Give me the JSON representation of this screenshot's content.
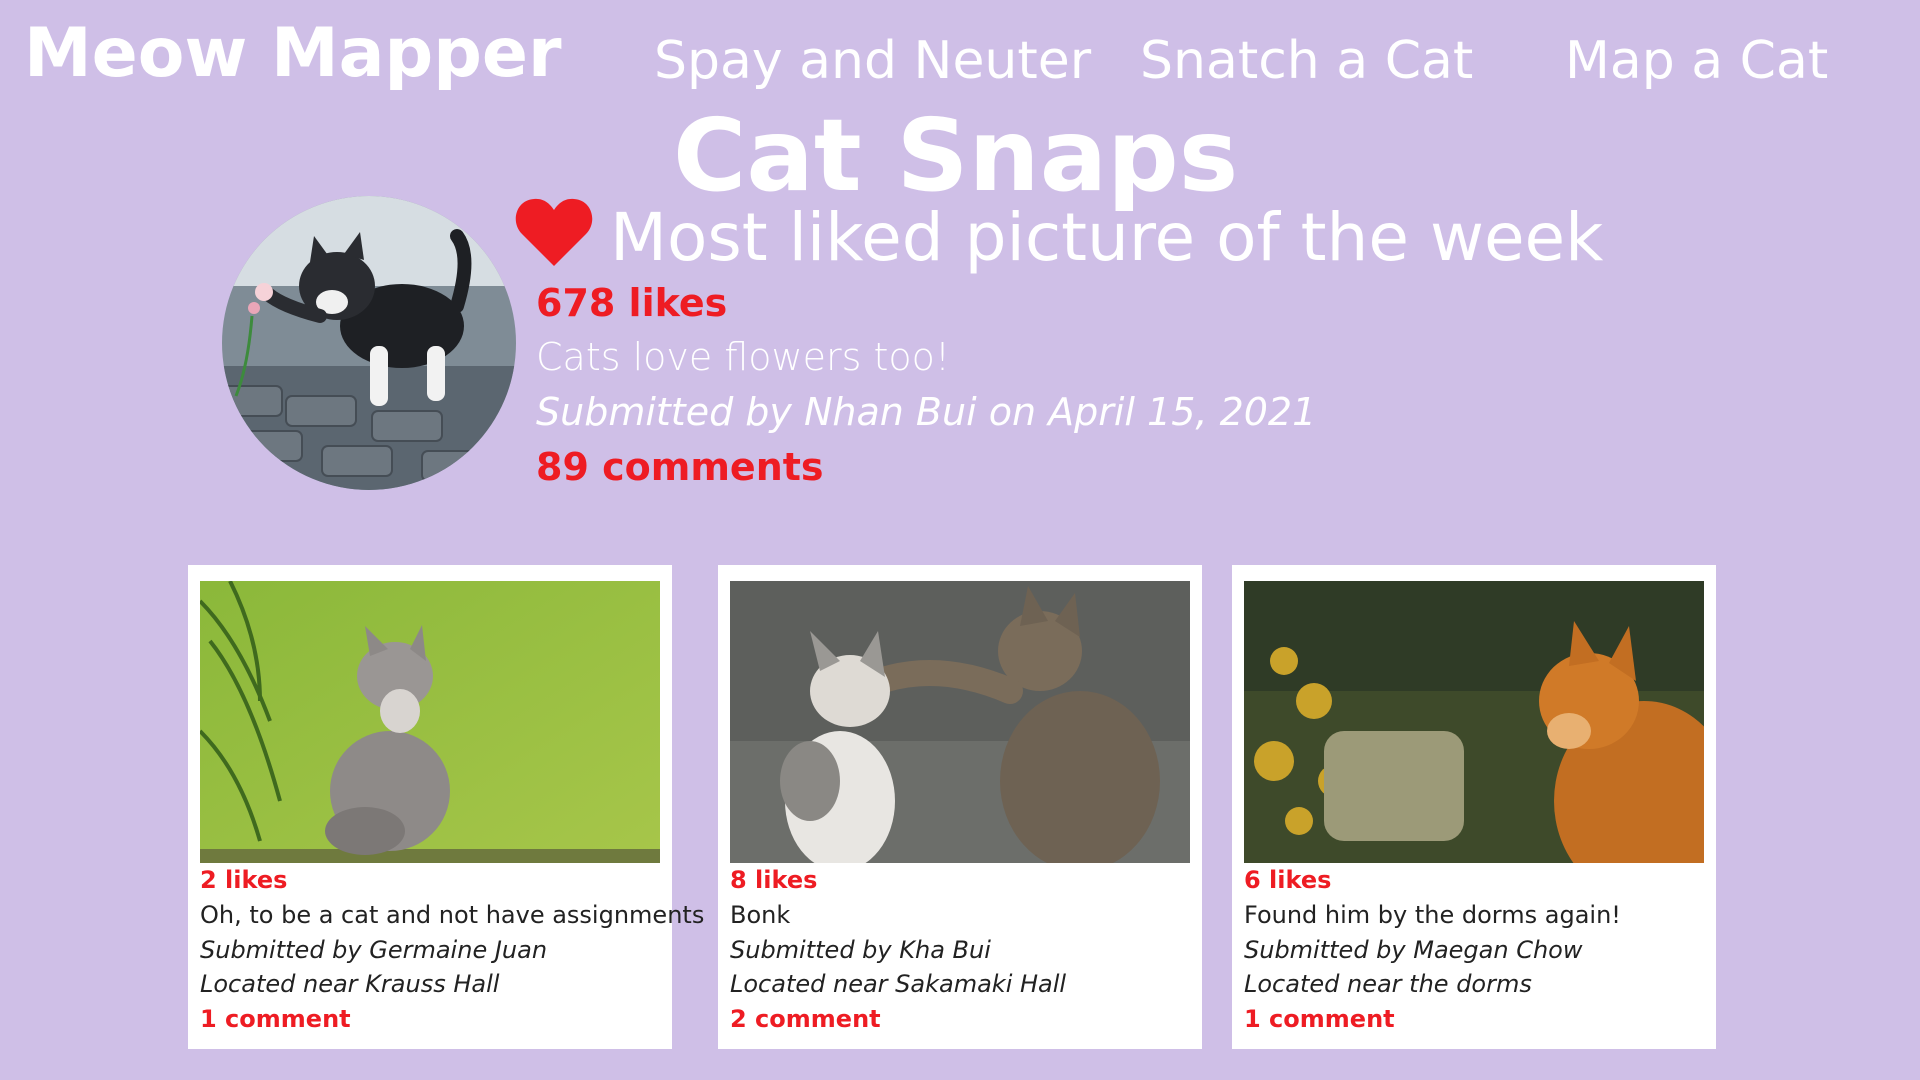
{
  "header": {
    "brand": "Meow Mapper",
    "nav": [
      "Spay and Neuter",
      "Snatch a Cat",
      "Map a Cat"
    ]
  },
  "page": {
    "title": "Cat Snaps"
  },
  "featured": {
    "heading": "Most liked picture of the week",
    "likes": "678 likes",
    "caption": "Cats love flowers too!",
    "submitted": "Submitted by Nhan Bui on April 15, 2021",
    "comments": "89 comments"
  },
  "cards": [
    {
      "likes": "2 likes",
      "caption": "Oh, to be a cat and not have assignments",
      "submitted": "Submitted by Germaine Juan",
      "location": "Located near Krauss Hall",
      "comments": "1 comment"
    },
    {
      "likes": "8 likes",
      "caption": "Bonk",
      "submitted": "Submitted by Kha Bui",
      "location": "Located near Sakamaki Hall",
      "comments": "2 comment"
    },
    {
      "likes": "6 likes",
      "caption": "Found him by the dorms again!",
      "submitted": "Submitted by Maegan Chow",
      "location": "Located near the dorms",
      "comments": "1 comment"
    }
  ],
  "colors": {
    "background": "#cfbfe7",
    "accent": "#ee1c23",
    "text": "#ffffff"
  }
}
